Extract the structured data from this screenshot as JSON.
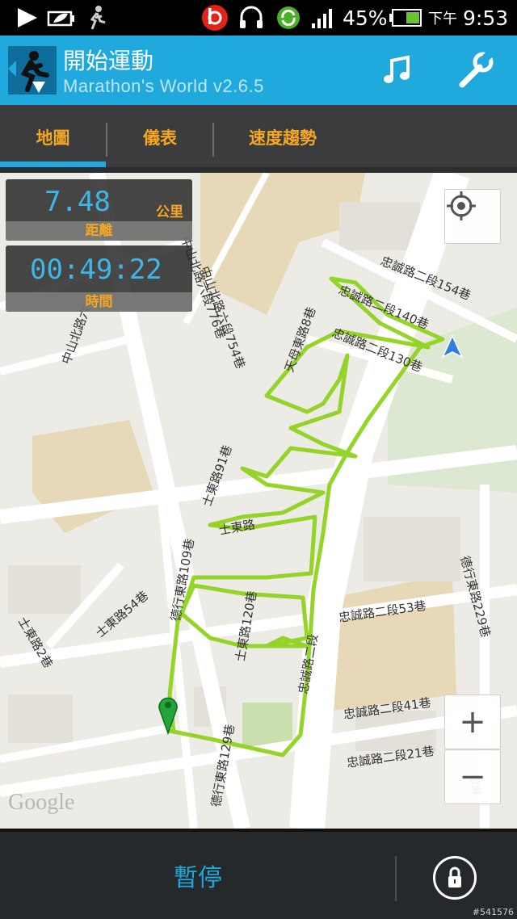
{
  "status_bar": {
    "battery_percent": "45%",
    "ampm": "下午",
    "time": "9:53",
    "icons": [
      "play-icon",
      "leaf-battery-icon",
      "runner-icon",
      "beats-icon",
      "headset-icon",
      "sync-icon",
      "signal-icon",
      "battery-icon"
    ]
  },
  "app": {
    "title": "開始運動",
    "subtitle": "Marathon's World v2.6.5",
    "icons": [
      "app-logo-icon",
      "music-note-icon",
      "wrench-icon"
    ]
  },
  "tabs": [
    {
      "label": "地圖",
      "active": true
    },
    {
      "label": "儀表",
      "active": false
    },
    {
      "label": "速度趨勢",
      "active": false
    }
  ],
  "stats": {
    "distance": {
      "value": "7.48",
      "unit": "公里",
      "caption": "距離"
    },
    "time": {
      "value": "00:49:22",
      "caption": "時間"
    }
  },
  "map": {
    "streets": {
      "s1": "中山北路六段776巷",
      "s2": "中山北路六段754巷",
      "s3": "中山北路六",
      "s4": "天母東路8巷",
      "s5": "忠誠路二段154巷",
      "s6": "忠誠路二段140巷",
      "s7": "忠誠路二段130巷",
      "s8": "士東路91巷",
      "s9": "士東路",
      "s10": "德行東路229巷",
      "s11": "士東路54巷",
      "s12": "德行東路109巷",
      "s13": "士東路120巷",
      "s14": "忠誠路二段",
      "s15": "忠誠路二段53巷",
      "s16": "士東路2巷",
      "s17": "忠誠路二段41巷",
      "s18": "德行東路129巷",
      "s19": "忠誠路二段21巷",
      "s20": "忠誠"
    },
    "attribution": "Google",
    "route_color": "#8fd21e",
    "zoom_in": "+",
    "zoom_out": "−"
  },
  "bottom": {
    "pause_label": "暫停"
  },
  "watermark": "#541576"
}
